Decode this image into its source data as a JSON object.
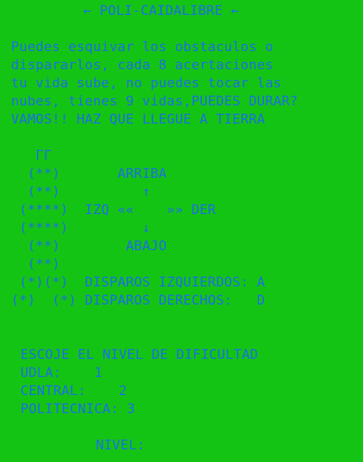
{
  "title": "← POLI-CAIDALIBRE ←",
  "intro": [
    "Puedes esquivar los obstaculos o",
    "dispararlos, cada 8 acertaciones",
    "tu vida sube, no puedes tocar las",
    "nubes, tienes 9 vidas,PUEDES DURAR?",
    "VAMOS!! HAZ QUE LLEGUE A TIERRA"
  ],
  "ascii_controls": [
    "   ΓΓ",
    "  (**)       ARRIBA",
    "  (**)          ↑",
    " (****)  IZQ ««    »» DER",
    " (****)         ↓",
    "  (**)        ABAJO",
    "  (**)",
    " (*)(*)  DISPAROS IZQUIERDOS: A",
    "(*)  (*) DISPAROS DERECHOS:   D"
  ],
  "menu": {
    "heading": "ESCOJE EL NIVEL DE DIFICULTAD",
    "options": [
      "UDLA:    1",
      "CENTRAL:    2",
      "POLITECNICA: 3"
    ],
    "prompt": "NIVEL:"
  },
  "colors": {
    "background": "#14c414",
    "text": "#1b6fe6"
  }
}
